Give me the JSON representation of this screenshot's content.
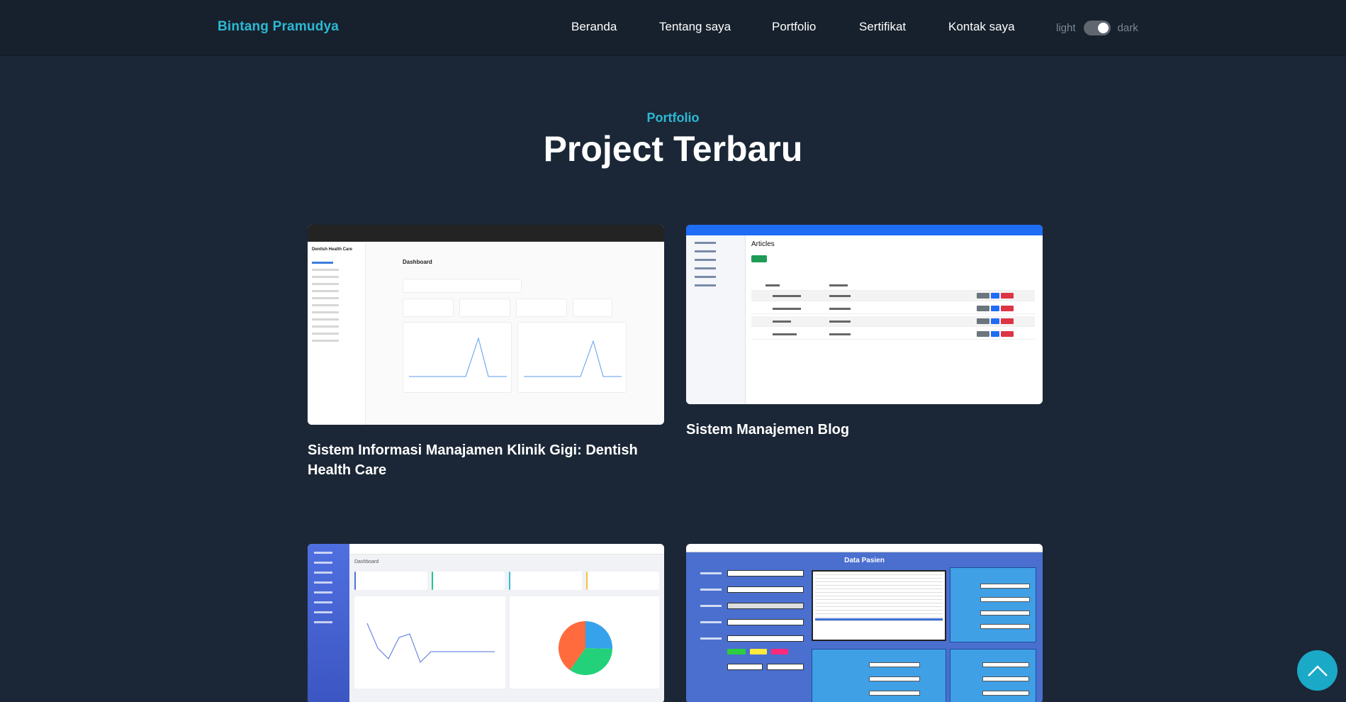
{
  "header": {
    "brand": "Bintang Pramudya",
    "nav": [
      {
        "label": "Beranda"
      },
      {
        "label": "Tentang saya"
      },
      {
        "label": "Portfolio"
      },
      {
        "label": "Sertifikat"
      },
      {
        "label": "Kontak saya"
      }
    ],
    "theme_toggle": {
      "left_label": "light",
      "right_label": "dark",
      "state": "dark"
    }
  },
  "section": {
    "eyebrow": "Portfolio",
    "title": "Project Terbaru"
  },
  "projects": [
    {
      "title": "Sistem Informasi Manajamen Klinik Gigi: Dentish Health Care",
      "thumb": {
        "app_name": "Dentish Health Care",
        "heading": "Dashboard"
      }
    },
    {
      "title": "Sistem Manajemen Blog",
      "thumb": {
        "heading": "Articles"
      }
    },
    {
      "title": "",
      "thumb": {
        "heading": "Dashboard"
      }
    },
    {
      "title": "",
      "thumb": {
        "heading": "Data Pasien"
      }
    }
  ],
  "scroll_top": {
    "icon": "chevron-up-icon"
  },
  "colors": {
    "background": "#1b2736",
    "navbar": "#17212d",
    "accent": "#2bb9d4",
    "scroll_button": "#1aa9c7"
  }
}
